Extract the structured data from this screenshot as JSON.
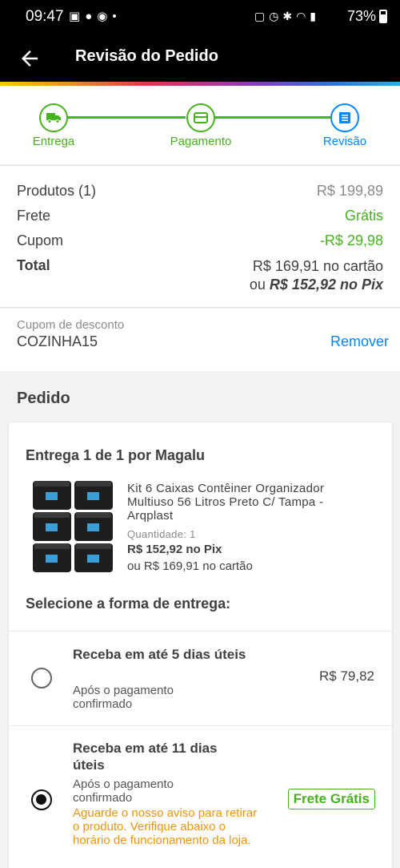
{
  "status_bar": {
    "time": "09:47",
    "battery": "73%",
    "icons": [
      "gallery-icon",
      "chat-icon",
      "whatsapp-icon",
      "dot-icon",
      "lock-icon",
      "alarm-icon",
      "bluetooth-icon",
      "wifi-icon",
      "volte-icon",
      "signal-icon",
      "battery-icon"
    ]
  },
  "header": {
    "title": "Revisão do Pedido",
    "back_icon": "arrow-left-icon"
  },
  "stepper": {
    "steps": [
      {
        "label": "Entrega",
        "icon": "truck-icon"
      },
      {
        "label": "Pagamento",
        "icon": "card-icon"
      },
      {
        "label": "Revisão",
        "icon": "list-icon"
      }
    ],
    "colors": {
      "done": "#46b21e",
      "current": "#0086ff"
    }
  },
  "summary": {
    "products_label": "Produtos (1)",
    "products_value": "R$ 199,89",
    "shipping_label": "Frete",
    "shipping_value": "Grátis",
    "coupon_label": "Cupom",
    "coupon_value": "-R$ 29,98",
    "total_label": "Total",
    "total_card": "R$ 169,91 no cartão",
    "total_pix_prefix": "ou ",
    "total_pix": "R$ 152,92 no Pix"
  },
  "coupon": {
    "label": "Cupom de desconto",
    "code": "COZINHA15",
    "remove_label": "Remover"
  },
  "order": {
    "section_title": "Pedido",
    "delivery_title": "Entrega 1 de 1 por Magalu",
    "product": {
      "name": "Kit 6 Caixas Contêiner Organizador Multiuso 56 Litros Preto C/ Tampa - Arqplast",
      "quantity_label": "Quantidade:",
      "quantity": "1",
      "price_pix": "R$ 152,92 no Pix",
      "price_card": "ou R$ 169,91 no cartão"
    },
    "select_delivery_title": "Selecione a forma de entrega:",
    "options": [
      {
        "title": "Receba em até 5 dias úteis",
        "subtitle": "Após o pagamento confirmado",
        "price": "R$ 79,82",
        "selected": false
      },
      {
        "title": "Receba em até 11 dias úteis",
        "subtitle": "Após o pagamento confirmado",
        "note": "Aguarde o nosso aviso para retirar o produto. Verifique abaixo o horário de funcionamento da loja.",
        "badge": "Frete Grátis",
        "selected": true
      }
    ]
  }
}
